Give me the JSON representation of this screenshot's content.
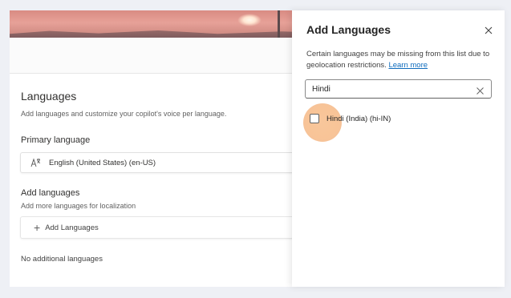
{
  "settings": {
    "title": "Languages",
    "description": "Add languages and customize your copilot's voice per language.",
    "primary_label": "Primary language",
    "primary_value": "English (United States) (en-US)",
    "add_label": "Add languages",
    "add_description": "Add more languages for localization",
    "add_button_label": "Add Languages",
    "empty_text": "No additional languages"
  },
  "panel": {
    "title": "Add Languages",
    "description": "Certain languages may be missing from this list due to geolocation restrictions.",
    "link_text": "Learn more",
    "search_value": "Hindi",
    "results": [
      {
        "label": "Hindi (India) (hi-IN)",
        "checked": false
      }
    ]
  },
  "colors": {
    "link": "#0f6cbd",
    "highlight": "#f7be8c"
  }
}
